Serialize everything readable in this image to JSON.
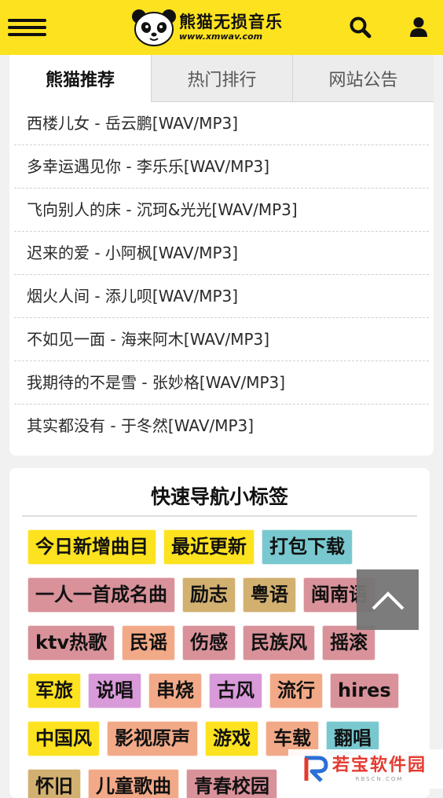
{
  "header": {
    "logo_cn": "熊猫无损音乐",
    "logo_url": "www.xmwav.com",
    "menu_icon": "hamburger-menu-icon",
    "search_icon": "search-icon",
    "user_icon": "user-icon",
    "bg_color": "#fde21f"
  },
  "tabs": [
    {
      "label": "熊猫推荐",
      "active": true
    },
    {
      "label": "热门排行",
      "active": false
    },
    {
      "label": "网站公告",
      "active": false
    }
  ],
  "songs": [
    "西楼儿女 - 岳云鹏[WAV/MP3]",
    "多幸运遇见你 - 李乐乐[WAV/MP3]",
    "飞向别人的床 - 沉珂&光光[WAV/MP3]",
    "迟来的爱 - 小阿枫[WAV/MP3]",
    "烟火人间 - 添儿呗[WAV/MP3]",
    "不如见一面 - 海来阿木[WAV/MP3]",
    "我期待的不是雪 - 张妙格[WAV/MP3]",
    "其实都没有 - 于冬然[WAV/MP3]"
  ],
  "quicknav": {
    "title": "快速导航小标签",
    "tags": [
      {
        "label": "今日新增曲目",
        "color": "#fde21f"
      },
      {
        "label": "最近更新",
        "color": "#fde21f"
      },
      {
        "label": "打包下载",
        "color": "#79c8cf"
      },
      {
        "label": "一人一首成名曲",
        "color": "#d9929a"
      },
      {
        "label": "励志",
        "color": "#d2b070"
      },
      {
        "label": "粤语",
        "color": "#d2b070"
      },
      {
        "label": "闽南语",
        "color": "#d9929a"
      },
      {
        "label": "ktv热歌",
        "color": "#d9929a"
      },
      {
        "label": "民谣",
        "color": "#f2a987"
      },
      {
        "label": "伤感",
        "color": "#d9929a"
      },
      {
        "label": "民族风",
        "color": "#d9929a"
      },
      {
        "label": "摇滚",
        "color": "#d9929a"
      },
      {
        "label": "军旅",
        "color": "#fde21f"
      },
      {
        "label": "说唱",
        "color": "#d99ad9"
      },
      {
        "label": "串烧",
        "color": "#f2a987"
      },
      {
        "label": "古风",
        "color": "#d99ad9"
      },
      {
        "label": "流行",
        "color": "#f2a987"
      },
      {
        "label": "hires",
        "color": "#d9929a"
      },
      {
        "label": "中国风",
        "color": "#fde21f"
      },
      {
        "label": "影视原声",
        "color": "#f2a987"
      },
      {
        "label": "游戏",
        "color": "#fde21f"
      },
      {
        "label": "车载",
        "color": "#f2a987"
      },
      {
        "label": "翻唱",
        "color": "#79c8cf"
      },
      {
        "label": "怀旧",
        "color": "#d2b070"
      },
      {
        "label": "儿童歌曲",
        "color": "#f2a987"
      },
      {
        "label": "青春校园",
        "color": "#d9929a"
      }
    ]
  },
  "back_to_top_icon": "chevron-up-icon",
  "watermark": {
    "name": "若宝软件园",
    "site": "RBSCN.COM"
  }
}
